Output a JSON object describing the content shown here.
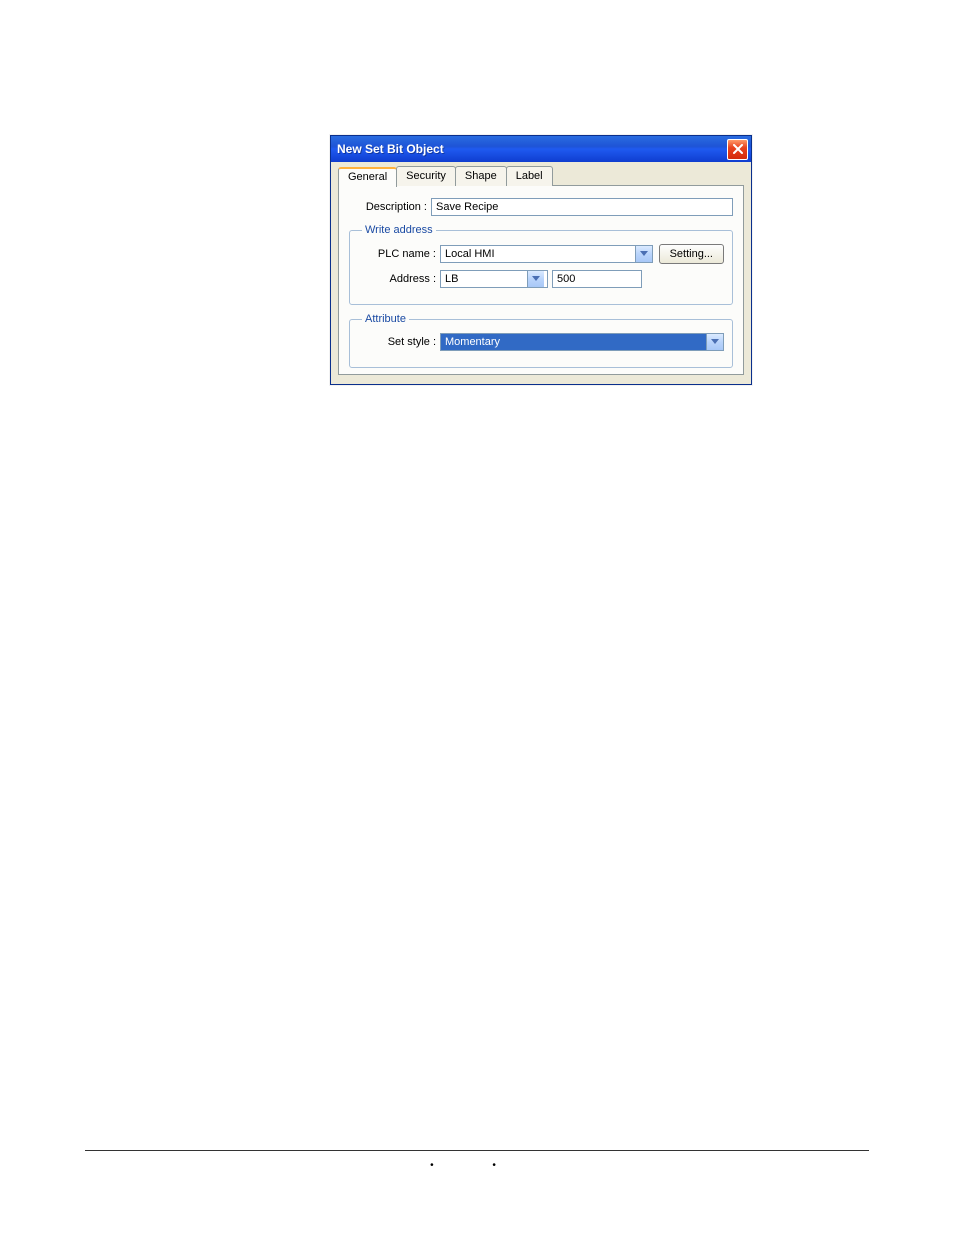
{
  "dialog": {
    "title": "New Set Bit Object",
    "tabs": [
      "General",
      "Security",
      "Shape",
      "Label"
    ],
    "active_tab": 0,
    "general": {
      "description_label": "Description :",
      "description_value": "Save Recipe",
      "write_address": {
        "legend": "Write address",
        "plc_label": "PLC name :",
        "plc_value": "Local HMI",
        "setting_button": "Setting...",
        "address_label": "Address :",
        "address_register": "LB",
        "address_number": "500"
      },
      "attribute": {
        "legend": "Attribute",
        "setstyle_label": "Set style :",
        "setstyle_value": "Momentary"
      }
    }
  },
  "footer": {
    "dots": "• •"
  }
}
